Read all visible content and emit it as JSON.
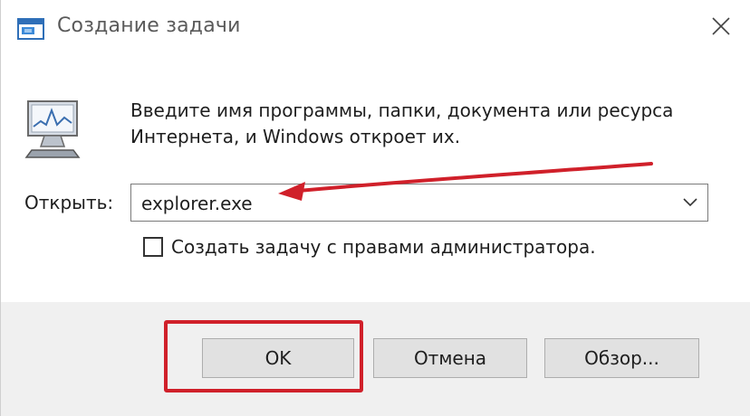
{
  "window": {
    "title": "Создание задачи",
    "title_icon": "run-dialog-icon",
    "close_icon": "close-icon"
  },
  "content": {
    "description": "Введите имя программы, папки, документа или ресурса Интернета, и Windows откроет их.",
    "open_label": "Открыть:",
    "open_value": "explorer.exe",
    "dropdown_icon": "chevron-down-icon",
    "admin_checkbox_label": "Создать задачу с правами администратора.",
    "admin_checkbox_checked": false
  },
  "buttons": {
    "ok": "OK",
    "cancel": "Отмена",
    "browse": "Обзор..."
  },
  "annotations": {
    "arrow_icon": "red-arrow-icon",
    "highlight_color": "#d0202a"
  }
}
